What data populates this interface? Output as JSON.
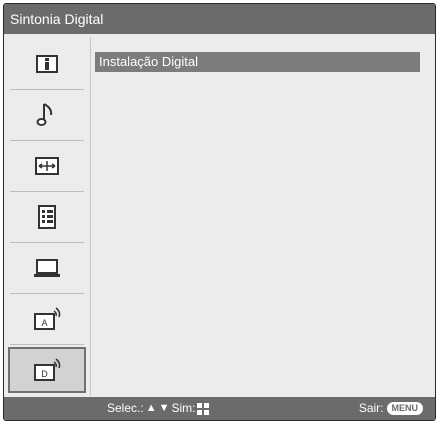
{
  "window": {
    "title": "Sintonia Digital"
  },
  "sidebar": {
    "items": [
      {
        "icon": "info-icon",
        "selected": false
      },
      {
        "icon": "music-note-icon",
        "selected": false
      },
      {
        "icon": "screen-adjust-icon",
        "selected": false
      },
      {
        "icon": "list-settings-icon",
        "selected": false
      },
      {
        "icon": "pc-monitor-icon",
        "selected": false
      },
      {
        "icon": "analog-antenna-icon",
        "selected": false
      },
      {
        "icon": "digital-antenna-icon",
        "selected": true
      }
    ]
  },
  "main": {
    "items": [
      {
        "label": "Instalação Digital",
        "highlighted": true
      }
    ]
  },
  "footer": {
    "select_label": "Selec.:",
    "confirm_label": "Sim:",
    "exit_label": "Sair:",
    "menu_key": "MENU"
  },
  "colors": {
    "bar": "#6b6b6b",
    "background": "#ececec",
    "highlight": "#7c7c7c"
  }
}
